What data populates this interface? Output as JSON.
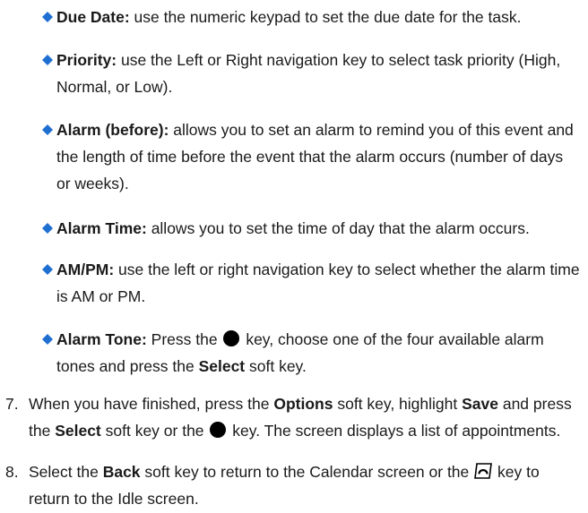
{
  "bullets": [
    {
      "label": "Due Date:",
      "text": " use the numeric keypad to set the due date for the task."
    },
    {
      "label": "Priority:",
      "text": " use the Left or Right navigation key to select task priority (High, Normal, or Low)."
    },
    {
      "label": "Alarm (before):",
      "text": " allows you to set an alarm to remind you of this event and the length of time before the event that the alarm occurs (number of days or weeks)."
    },
    {
      "label": "Alarm Time:",
      "text": " allows you to set the time of day that the alarm occurs."
    },
    {
      "label": "AM/PM:",
      "text": " use the left or right navigation key to select whether the alarm time is AM or PM."
    },
    {
      "label": "Alarm Tone:",
      "text_1": " Press the ",
      "text_2": " key, choose one of the four available alarm tones and press the ",
      "bold_1": "Select",
      "text_3": " soft key."
    }
  ],
  "steps": [
    {
      "number": "7.",
      "t1": "When you have finished, press the ",
      "b1": "Options",
      "t2": " soft key, highlight ",
      "b2": "Save",
      "t3": " and press the ",
      "b3": "Select",
      "t4": " soft key or the ",
      "t5": " key. The screen displays a list of appointments."
    },
    {
      "number": "8.",
      "t1": "Select the ",
      "b1": "Back",
      "t2": " soft key to return to the Calendar screen or the ",
      "t3": " key to return to the Idle screen."
    }
  ],
  "icons": {
    "bullet": "diamond-bullet-icon",
    "ok_key": "select-key-icon",
    "end_key": "end-key-icon"
  },
  "colors": {
    "bullet": "#1f6fd1",
    "text": "#1a1a1a"
  }
}
